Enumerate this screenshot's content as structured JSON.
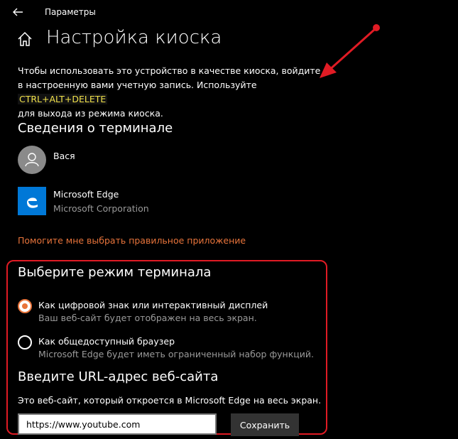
{
  "window": {
    "app_title": "Параметры"
  },
  "header": {
    "title": "Настройка киоска"
  },
  "description": {
    "text_before": "Чтобы использовать это устройство в качестве киоска, войдите в настроенную вами учетную запись. Используйте ",
    "hotkey": "CTRL+ALT+DELETE",
    "text_after": "для выхода из режима киоска."
  },
  "terminal_info": {
    "title": "Сведения о терминале",
    "account_name": "Вася",
    "app_name": "Microsoft Edge",
    "app_publisher": "Microsoft Corporation",
    "help_link": "Помогите мне выбрать правильное приложение"
  },
  "mode": {
    "title": "Выберите режим терминала",
    "options": [
      {
        "label": "Как цифровой знак или интерактивный дисплей",
        "sub": "Ваш веб-сайт будет отображен на весь экран.",
        "checked": true
      },
      {
        "label": "Как общедоступный браузер",
        "sub": "Microsoft Edge будет иметь ограниченный набор функций.",
        "checked": false
      }
    ]
  },
  "url": {
    "title": "Введите URL-адрес веб-сайта",
    "description": "Это веб-сайт, который откроется в Microsoft Edge на весь экран.",
    "value": "https://www.youtube.com",
    "save_label": "Сохранить"
  },
  "colors": {
    "accent": "#e8743b",
    "annotation": "#e01b24",
    "hotkey_text": "#f2e24b",
    "edge_blue": "#0078d7"
  },
  "icons": {
    "back": "back-arrow-icon",
    "home": "home-icon",
    "user": "user-icon",
    "edge": "edge-logo-icon"
  }
}
